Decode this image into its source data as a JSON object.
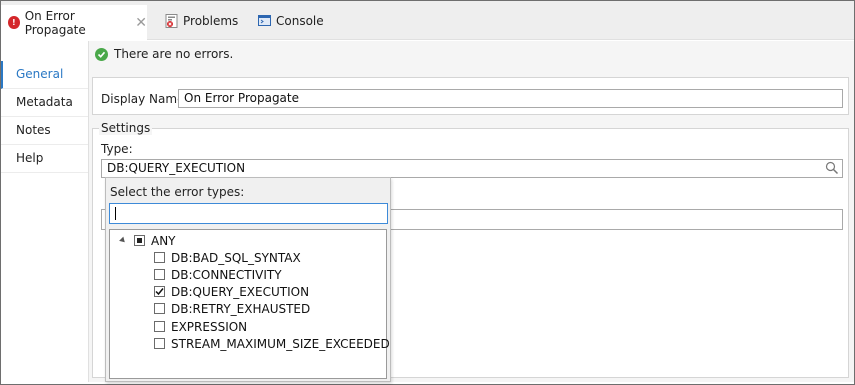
{
  "tabs": [
    {
      "label": "On Error Propagate",
      "icon": "flow-error-icon",
      "active": true,
      "closable": true
    },
    {
      "label": "Problems",
      "icon": "problems-icon",
      "active": false
    },
    {
      "label": "Console",
      "icon": "console-icon",
      "active": false
    }
  ],
  "sidebar": {
    "items": [
      {
        "label": "General",
        "active": true
      },
      {
        "label": "Metadata",
        "active": false
      },
      {
        "label": "Notes",
        "active": false
      },
      {
        "label": "Help",
        "active": false
      }
    ]
  },
  "status": {
    "text": "There are no errors.",
    "icon": "check-circle-icon"
  },
  "display_name": {
    "label": "Display Name:",
    "value": "On Error Propagate"
  },
  "settings": {
    "legend": "Settings",
    "type_label": "Type:",
    "type_value": "DB:QUERY_EXECUTION"
  },
  "popup": {
    "title": "Select the error types:",
    "filter_value": "",
    "tree": {
      "root": {
        "label": "ANY",
        "state": "partial",
        "expanded": true
      },
      "children": [
        {
          "label": "DB:BAD_SQL_SYNTAX",
          "checked": false
        },
        {
          "label": "DB:CONNECTIVITY",
          "checked": false
        },
        {
          "label": "DB:QUERY_EXECUTION",
          "checked": true
        },
        {
          "label": "DB:RETRY_EXHAUSTED",
          "checked": false
        },
        {
          "label": "EXPRESSION",
          "checked": false
        },
        {
          "label": "STREAM_MAXIMUM_SIZE_EXCEEDED",
          "checked": false
        }
      ]
    }
  },
  "colors": {
    "accent": "#2a78c4",
    "error_red": "#d4272b",
    "success_green": "#4aa84a"
  }
}
